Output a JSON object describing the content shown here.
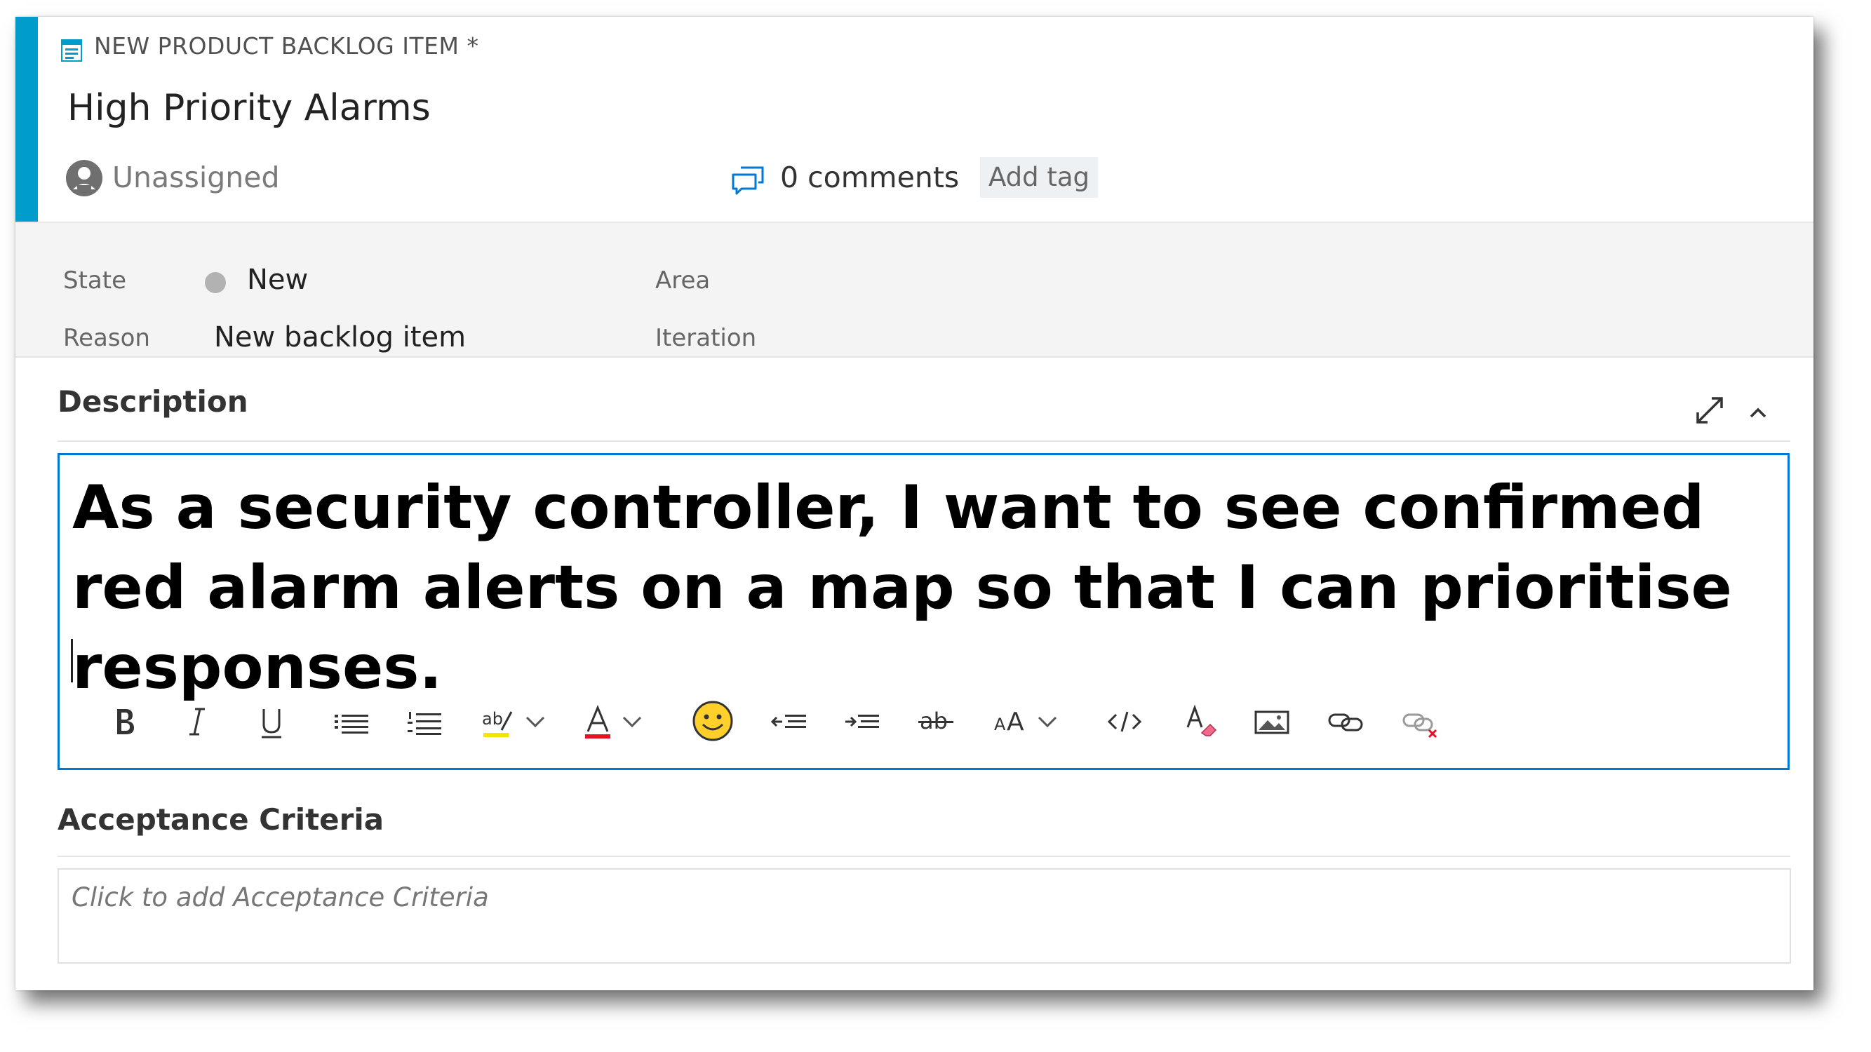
{
  "work_item": {
    "type_label": "NEW PRODUCT BACKLOG ITEM *",
    "title": "High Priority Alarms",
    "assignee": "Unassigned",
    "comments": "0 comments",
    "add_tag": "Add tag",
    "accent_color": "#009ccc"
  },
  "fields": {
    "state_label": "State",
    "state_value": "New",
    "reason_label": "Reason",
    "reason_value": "New backlog item",
    "area_label": "Area",
    "iteration_label": "Iteration"
  },
  "description": {
    "header": "Description",
    "text": "As a security controller, I want to see confirmed red alarm alerts on a map so that I can prioritise responses.",
    "toolbar": [
      "bold-icon",
      "italic-icon",
      "underline-icon",
      "bulleted-list-icon",
      "numbered-list-icon",
      "highlight-icon",
      "chevron-down-icon",
      "font-color-icon",
      "chevron-down-icon",
      "emoji-icon",
      "decrease-indent-icon",
      "increase-indent-icon",
      "strikethrough-icon",
      "font-size-icon",
      "chevron-down-icon",
      "code-icon",
      "clear-format-icon",
      "insert-image-icon",
      "link-icon",
      "unlink-icon"
    ]
  },
  "acceptance_criteria": {
    "header": "Acceptance Criteria",
    "placeholder": "Click to add Acceptance Criteria"
  }
}
